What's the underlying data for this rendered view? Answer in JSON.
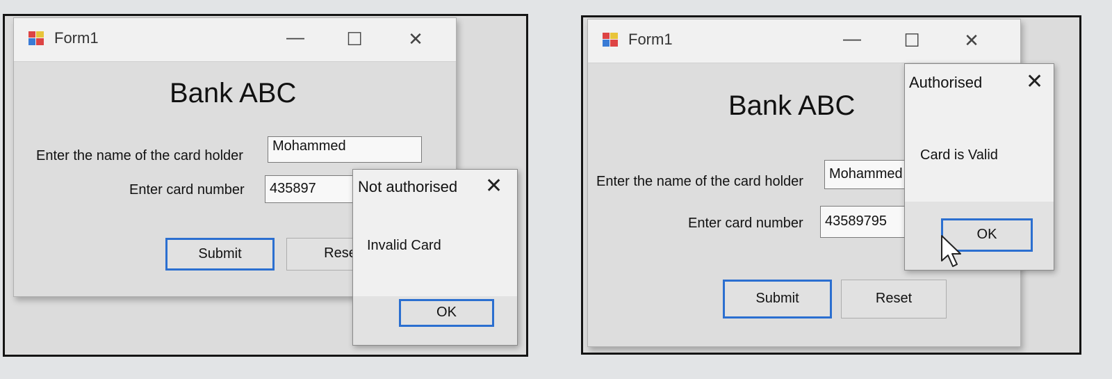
{
  "left_screen": {
    "window": {
      "title": "Form1",
      "controls": {
        "minimize": "—",
        "maximize": "☐",
        "close": "✕"
      }
    },
    "form": {
      "heading": "Bank ABC",
      "name_label": "Enter the name of the card holder",
      "name_value": "Mohammed",
      "card_label": "Enter card number",
      "card_value": "435897",
      "submit_label": "Submit",
      "reset_label": "Rese"
    },
    "dialog": {
      "title": "Not authorised",
      "close": "✕",
      "message": "Invalid Card",
      "ok_label": "OK"
    }
  },
  "right_screen": {
    "window": {
      "title": "Form1",
      "controls": {
        "minimize": "—",
        "maximize": "☐",
        "close": "✕"
      }
    },
    "form": {
      "heading": "Bank ABC",
      "name_label": "Enter the name of the card holder",
      "name_value": "Mohammed",
      "card_label": "Enter card number",
      "card_value": "43589795",
      "submit_label": "Submit",
      "reset_label": "Reset"
    },
    "dialog": {
      "title": "Authorised",
      "close": "✕",
      "message": "Card is Valid",
      "ok_label": "OK"
    }
  },
  "colors": {
    "focus_border": "#2b6fd0",
    "form_bg": "#dddddd",
    "titlebar_bg": "#f1f1f1",
    "frame": "#141414"
  }
}
